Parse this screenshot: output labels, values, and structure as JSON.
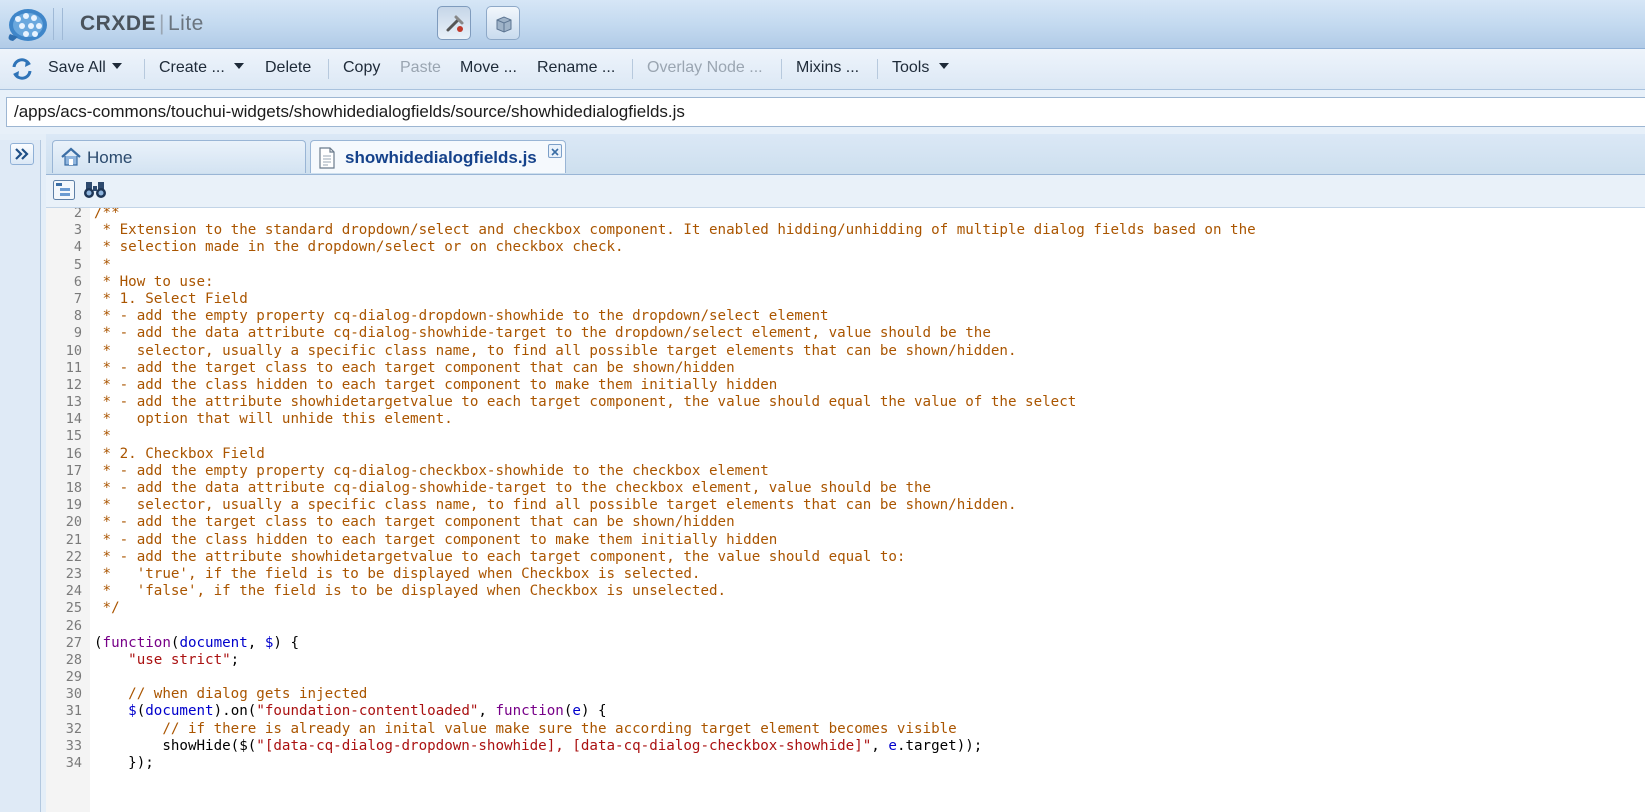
{
  "app": {
    "name": "CRXDE",
    "edition": "Lite"
  },
  "toolbar": {
    "save_all": "Save All",
    "create": "Create ...",
    "delete": "Delete",
    "copy": "Copy",
    "paste": "Paste",
    "move": "Move ...",
    "rename": "Rename ...",
    "overlay_node": "Overlay Node ...",
    "mixins": "Mixins ...",
    "tools": "Tools"
  },
  "path": {
    "value": "/apps/acs-commons/touchui-widgets/showhidedialogfields/source/showhidedialogfields.js"
  },
  "tabs": [
    {
      "label": "Home"
    },
    {
      "label": "showhidedialogfields.js"
    }
  ],
  "code": [
    {
      "n": "2",
      "tokens": [
        {
          "t": "/**",
          "c": "comment"
        }
      ]
    },
    {
      "n": "3",
      "tokens": [
        {
          "t": " * Extension to the standard dropdown/select and checkbox component. It enabled hidding/unhidding of multiple dialog fields based on the",
          "c": "comment"
        }
      ]
    },
    {
      "n": "4",
      "tokens": [
        {
          "t": " * selection made in the dropdown/select or on checkbox check.",
          "c": "comment"
        }
      ]
    },
    {
      "n": "5",
      "tokens": [
        {
          "t": " *",
          "c": "comment"
        }
      ]
    },
    {
      "n": "6",
      "tokens": [
        {
          "t": " * How to use:",
          "c": "comment"
        }
      ]
    },
    {
      "n": "7",
      "tokens": [
        {
          "t": " * 1. Select Field",
          "c": "comment"
        }
      ]
    },
    {
      "n": "8",
      "tokens": [
        {
          "t": " * - add the empty property cq-dialog-dropdown-showhide to the dropdown/select element",
          "c": "comment"
        }
      ]
    },
    {
      "n": "9",
      "tokens": [
        {
          "t": " * - add the data attribute cq-dialog-showhide-target to the dropdown/select element, value should be the",
          "c": "comment"
        }
      ]
    },
    {
      "n": "10",
      "tokens": [
        {
          "t": " *   selector, usually a specific class name, to find all possible target elements that can be shown/hidden.",
          "c": "comment"
        }
      ]
    },
    {
      "n": "11",
      "tokens": [
        {
          "t": " * - add the target class to each target component that can be shown/hidden",
          "c": "comment"
        }
      ]
    },
    {
      "n": "12",
      "tokens": [
        {
          "t": " * - add the class hidden to each target component to make them initially hidden",
          "c": "comment"
        }
      ]
    },
    {
      "n": "13",
      "tokens": [
        {
          "t": " * - add the attribute showhidetargetvalue to each target component, the value should equal the value of the select",
          "c": "comment"
        }
      ]
    },
    {
      "n": "14",
      "tokens": [
        {
          "t": " *   option that will unhide this element.",
          "c": "comment"
        }
      ]
    },
    {
      "n": "15",
      "tokens": [
        {
          "t": " *",
          "c": "comment"
        }
      ]
    },
    {
      "n": "16",
      "tokens": [
        {
          "t": " * 2. Checkbox Field",
          "c": "comment"
        }
      ]
    },
    {
      "n": "17",
      "tokens": [
        {
          "t": " * - add the empty property cq-dialog-checkbox-showhide to the checkbox element",
          "c": "comment"
        }
      ]
    },
    {
      "n": "18",
      "tokens": [
        {
          "t": " * - add the data attribute cq-dialog-showhide-target to the checkbox element, value should be the",
          "c": "comment"
        }
      ]
    },
    {
      "n": "19",
      "tokens": [
        {
          "t": " *   selector, usually a specific class name, to find all possible target elements that can be shown/hidden.",
          "c": "comment"
        }
      ]
    },
    {
      "n": "20",
      "tokens": [
        {
          "t": " * - add the target class to each target component that can be shown/hidden",
          "c": "comment"
        }
      ]
    },
    {
      "n": "21",
      "tokens": [
        {
          "t": " * - add the class hidden to each target component to make them initially hidden",
          "c": "comment"
        }
      ]
    },
    {
      "n": "22",
      "tokens": [
        {
          "t": " * - add the attribute showhidetargetvalue to each target component, the value should equal to:",
          "c": "comment"
        }
      ]
    },
    {
      "n": "23",
      "tokens": [
        {
          "t": " *   'true', if the field is to be displayed when Checkbox is selected.",
          "c": "comment"
        }
      ]
    },
    {
      "n": "24",
      "tokens": [
        {
          "t": " *   'false', if the field is to be displayed when Checkbox is unselected.",
          "c": "comment"
        }
      ]
    },
    {
      "n": "25",
      "tokens": [
        {
          "t": " */",
          "c": "comment"
        }
      ]
    },
    {
      "n": "26",
      "tokens": []
    },
    {
      "n": "27",
      "tokens": [
        {
          "t": "(",
          "c": "plain"
        },
        {
          "t": "function",
          "c": "keyword"
        },
        {
          "t": "(",
          "c": "plain"
        },
        {
          "t": "document",
          "c": "var"
        },
        {
          "t": ", ",
          "c": "plain"
        },
        {
          "t": "$",
          "c": "var"
        },
        {
          "t": ") {",
          "c": "plain"
        }
      ]
    },
    {
      "n": "28",
      "tokens": [
        {
          "t": "    ",
          "c": "plain"
        },
        {
          "t": "\"use strict\"",
          "c": "string"
        },
        {
          "t": ";",
          "c": "plain"
        }
      ]
    },
    {
      "n": "29",
      "tokens": []
    },
    {
      "n": "30",
      "tokens": [
        {
          "t": "    // when dialog gets injected",
          "c": "comment"
        }
      ]
    },
    {
      "n": "31",
      "tokens": [
        {
          "t": "    ",
          "c": "plain"
        },
        {
          "t": "$",
          "c": "var"
        },
        {
          "t": "(",
          "c": "plain"
        },
        {
          "t": "document",
          "c": "var"
        },
        {
          "t": ").on(",
          "c": "plain"
        },
        {
          "t": "\"foundation-contentloaded\"",
          "c": "string"
        },
        {
          "t": ", ",
          "c": "plain"
        },
        {
          "t": "function",
          "c": "keyword"
        },
        {
          "t": "(",
          "c": "plain"
        },
        {
          "t": "e",
          "c": "var"
        },
        {
          "t": ") {",
          "c": "plain"
        }
      ]
    },
    {
      "n": "32",
      "tokens": [
        {
          "t": "        // if there is already an inital value make sure the according target element becomes visible",
          "c": "comment"
        }
      ]
    },
    {
      "n": "33",
      "tokens": [
        {
          "t": "        showHide($(",
          "c": "plain"
        },
        {
          "t": "\"[data-cq-dialog-dropdown-showhide], [data-cq-dialog-checkbox-showhide]\"",
          "c": "string"
        },
        {
          "t": ", ",
          "c": "plain"
        },
        {
          "t": "e",
          "c": "var"
        },
        {
          "t": ".target));",
          "c": "plain"
        }
      ]
    },
    {
      "n": "34",
      "tokens": [
        {
          "t": "    });",
          "c": "plain"
        }
      ]
    }
  ]
}
